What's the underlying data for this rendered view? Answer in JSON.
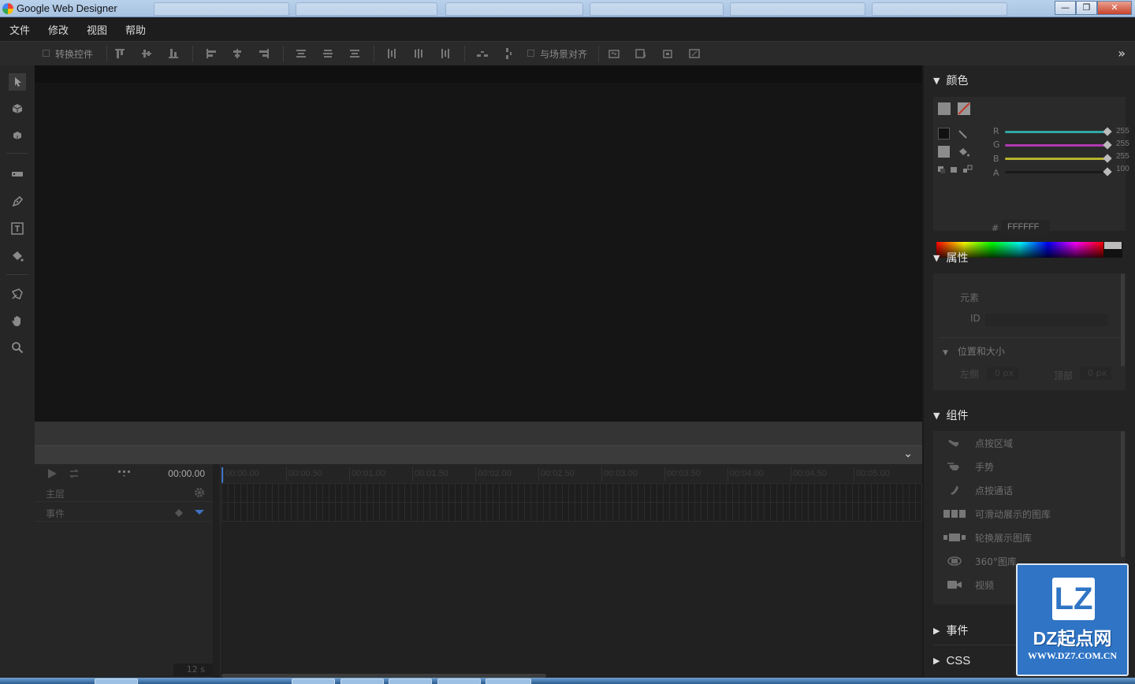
{
  "window": {
    "title": "Google Web Designer",
    "controls": {
      "minimize": "—",
      "maximize": "❐",
      "close": "✕"
    }
  },
  "menu": [
    "文件",
    "修改",
    "视图",
    "帮助"
  ],
  "toolbar": {
    "transform_controls_label": "转换控件",
    "align_to_stage_label": "与场景对齐",
    "expand_icon": "»"
  },
  "tools": [
    "select-icon",
    "3d-rotate-icon",
    "3d-translate-icon",
    "tag-icon",
    "pen-icon",
    "text-icon",
    "paint-bucket-icon",
    "eyedropper-3d-icon",
    "hand-icon",
    "zoom-icon"
  ],
  "timeline": {
    "collapse_icon": "⌄",
    "current_time": "00:00.00",
    "rows": [
      "主层",
      "事件"
    ],
    "zoom_label": "12 s",
    "ruler": [
      "00:00.00",
      "00:00.50",
      "00:01.00",
      "00:01.50",
      "00:02.00",
      "00:02.50",
      "00:03.00",
      "00:03.50",
      "00:04.00",
      "00:04.50",
      "00:05.00"
    ]
  },
  "panels": {
    "color": {
      "title": "颜色",
      "channels": [
        {
          "label": "R",
          "value": "255",
          "color": "#2fa7a5"
        },
        {
          "label": "G",
          "value": "255",
          "color": "#b03ab0"
        },
        {
          "label": "B",
          "value": "255",
          "color": "#b6b32e"
        },
        {
          "label": "A",
          "value": "100",
          "color": "#1a1a1a"
        }
      ],
      "hash": "#",
      "hex": "FFFFFF"
    },
    "properties": {
      "title": "属性",
      "element_label": "元素",
      "id_label": "ID",
      "position_size_title": "位置和大小",
      "left_label": "左侧",
      "left_value": "0 px",
      "top_label": "顶部",
      "top_value": "0 px"
    },
    "components": {
      "title": "组件",
      "items": [
        {
          "label": "点按区域",
          "icon": "tap-area-icon"
        },
        {
          "label": "手势",
          "icon": "swipe-gesture-icon"
        },
        {
          "label": "点按通话",
          "icon": "phone-icon"
        },
        {
          "label": "可滑动展示的图库",
          "icon": "swipeable-gallery-icon"
        },
        {
          "label": "轮换展示图库",
          "icon": "carousel-gallery-icon"
        },
        {
          "label": "360°图库",
          "icon": "360-gallery-icon"
        },
        {
          "label": "视频",
          "icon": "video-icon"
        }
      ]
    },
    "events": {
      "title": "事件"
    },
    "css": {
      "title": "CSS"
    }
  },
  "watermark": {
    "logo": "LZ",
    "title": "DZ起点网",
    "url": "WWW.DZ7.COM.CN",
    "bg": "#2f74c5"
  }
}
